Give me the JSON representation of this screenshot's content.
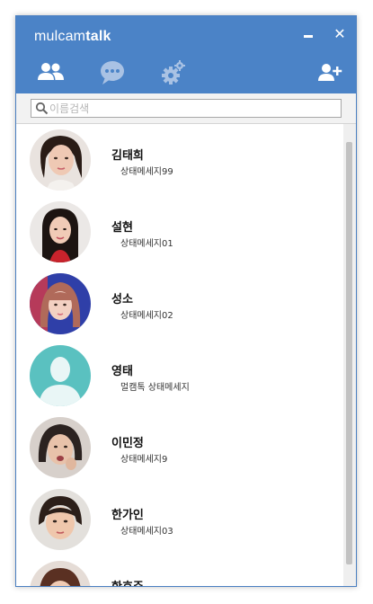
{
  "app": {
    "brand_light": "mulcam",
    "brand_bold": "talk"
  },
  "window": {
    "minimize_icon": "minimize-icon",
    "close_icon": "close-icon",
    "close_glyph": "✕"
  },
  "tabs": [
    {
      "name": "friends",
      "icon": "people-icon"
    },
    {
      "name": "chat",
      "icon": "chat-bubble-icon"
    },
    {
      "name": "settings",
      "icon": "gear-icon"
    },
    {
      "name": "add-friend",
      "icon": "add-user-icon"
    }
  ],
  "search": {
    "placeholder": "이름검색",
    "value": ""
  },
  "friends": [
    {
      "name": "김태희",
      "status": "상태메세지99",
      "avatar": "photo"
    },
    {
      "name": "설현",
      "status": "상태메세지01",
      "avatar": "photo"
    },
    {
      "name": "성소",
      "status": "상태메세지02",
      "avatar": "photo"
    },
    {
      "name": "영태",
      "status": "멀캠톡 상태메세지",
      "avatar": "default-silhouette"
    },
    {
      "name": "이민정",
      "status": "상태메세지9",
      "avatar": "photo"
    },
    {
      "name": "한가인",
      "status": "상태메세지03",
      "avatar": "photo"
    },
    {
      "name": "한효주",
      "status": "",
      "avatar": "photo"
    }
  ],
  "colors": {
    "titlebar": "#4b83c7",
    "silhouette_bg": "#5ac1c0"
  }
}
